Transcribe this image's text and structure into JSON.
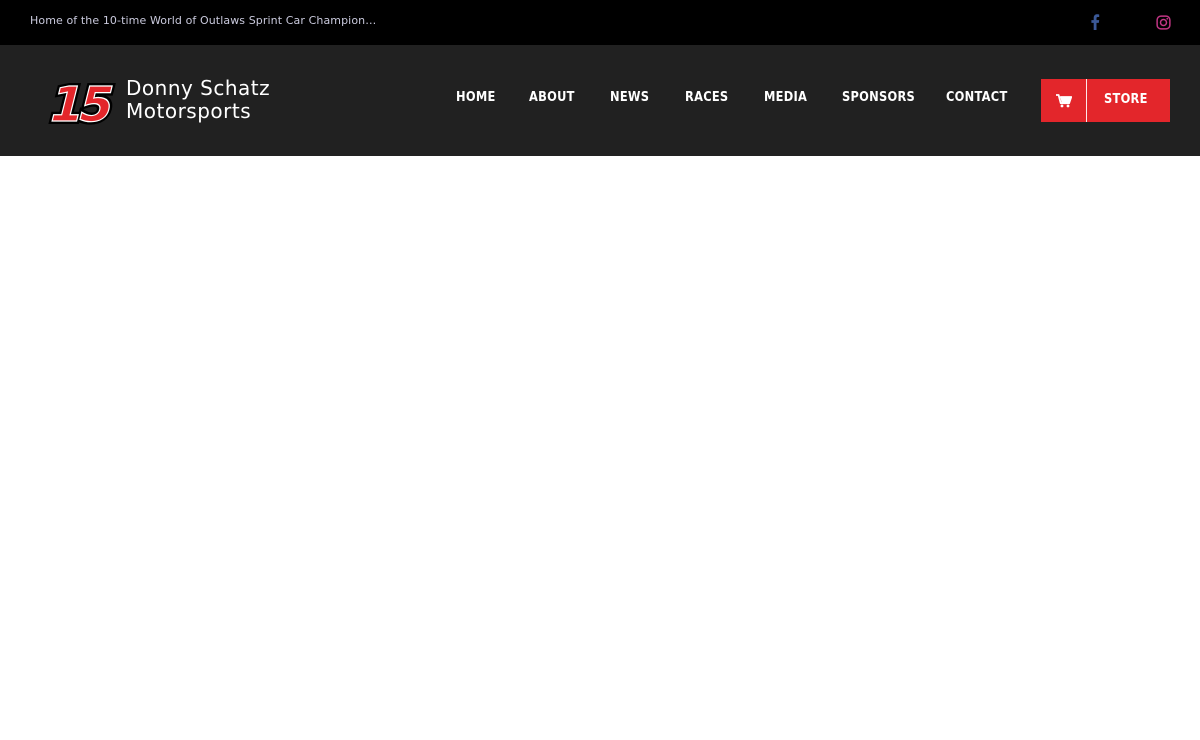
{
  "topbar": {
    "tagline": "Home of the 10-time World of Outlaws Sprint Car Champion…",
    "social": [
      {
        "name": "facebook-icon",
        "color": "#3b5998"
      },
      {
        "name": "instagram-icon",
        "color": "#c13584"
      }
    ]
  },
  "header": {
    "logo": {
      "number": "15",
      "line1": "Donny Schatz",
      "line2": "Motorsports",
      "accent": "#e3262b"
    },
    "nav": [
      {
        "label": "HOME"
      },
      {
        "label": "ABOUT"
      },
      {
        "label": "NEWS"
      },
      {
        "label": "RACES"
      },
      {
        "label": "MEDIA"
      },
      {
        "label": "SPONSORS"
      },
      {
        "label": "CONTACT"
      }
    ],
    "store": {
      "label": "STORE",
      "icon": "cart-icon",
      "color": "#e3262b"
    }
  },
  "colors": {
    "topbar_bg": "#000000",
    "header_bg": "#212121",
    "accent": "#e3262b"
  }
}
